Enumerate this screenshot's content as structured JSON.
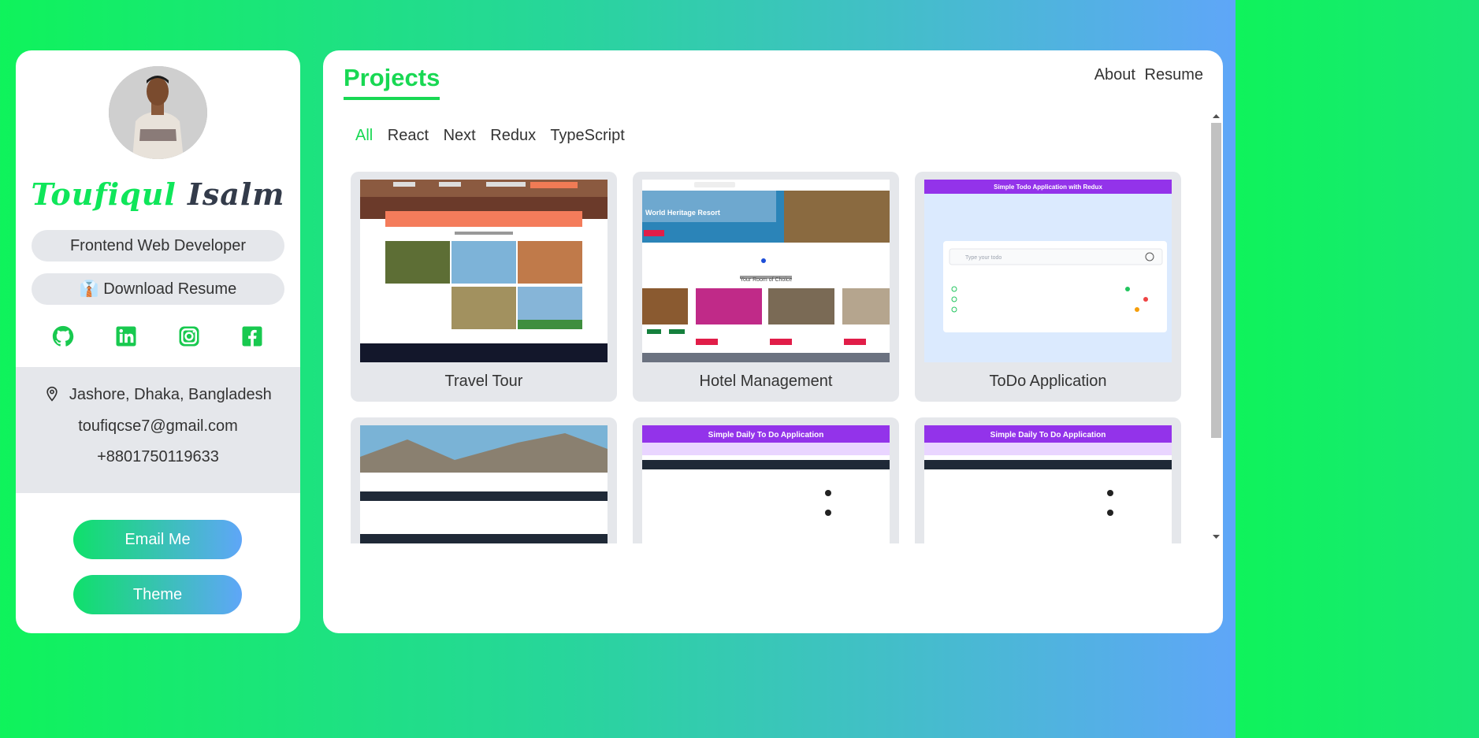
{
  "profile": {
    "first_name": "Toufiqul",
    "last_name": "Isalm",
    "role": "Frontend Web Developer",
    "download_label": "Download Resume",
    "download_icon": "👔",
    "socials": [
      "github-icon",
      "linkedin-icon",
      "instagram-icon",
      "facebook-icon"
    ],
    "location": "Jashore, Dhaka, Bangladesh",
    "email": "toufiqcse7@gmail.com",
    "phone": "+8801750119633",
    "email_button": "Email Me",
    "theme_button": "Theme"
  },
  "header": {
    "title": "Projects",
    "nav": [
      "About",
      "Resume"
    ]
  },
  "filters": [
    "All",
    "React",
    "Next",
    "Redux",
    "TypeScript"
  ],
  "projects": [
    {
      "title": "Travel Tour"
    },
    {
      "title": "Hotel Management",
      "hero": "World Heritage Resort",
      "section": "Your Room of Choice"
    },
    {
      "title": "ToDo Application",
      "banner": "Simple Todo Application with Redux",
      "placeholder": "Type your todo"
    },
    {
      "title": ""
    },
    {
      "title": "",
      "banner": "Simple Daily To Do Application"
    },
    {
      "title": "",
      "banner": "Simple Daily To Do Application"
    }
  ],
  "colors": {
    "accent": "#18d853",
    "pill_bg": "#e5e7eb",
    "todo_banner": "#9333ea"
  }
}
